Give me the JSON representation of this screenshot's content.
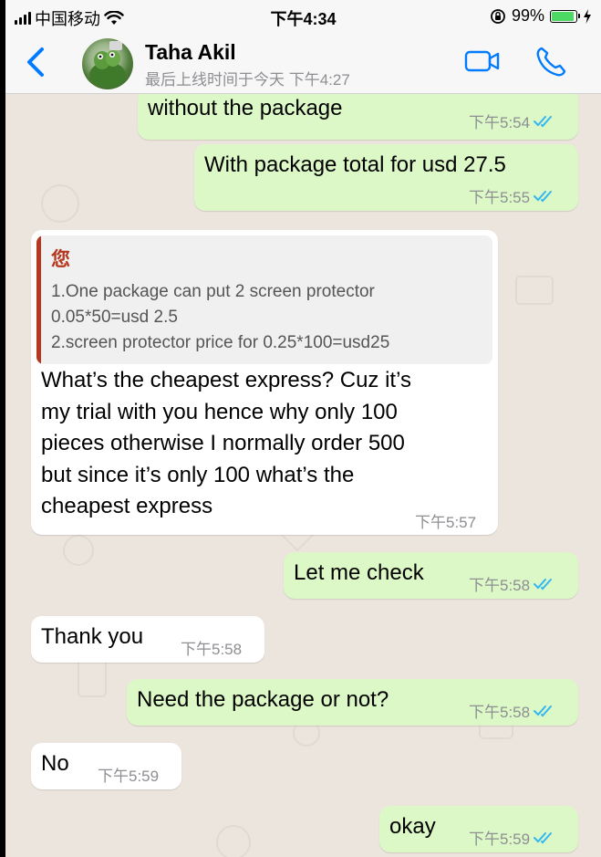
{
  "status_bar": {
    "carrier": "中国移动",
    "time": "下午4:34",
    "battery": "99%"
  },
  "header": {
    "contact_name": "Taha Akil",
    "last_seen": "最后上线时间于今天 下午4:27"
  },
  "colors": {
    "outgoing_bubble": "#DCF8C6",
    "incoming_bubble": "#FFFFFF",
    "chat_background": "#ECE5DD",
    "accent_blue": "#007AFF",
    "read_ticks": "#34B7F1",
    "quote_author": "#B5371F"
  },
  "messages": [
    {
      "direction": "out",
      "text": "without the package",
      "time": "下午5:54",
      "read": true
    },
    {
      "direction": "out",
      "text": "With package total for usd 27.5",
      "time": "下午5:55",
      "read": true
    },
    {
      "direction": "in",
      "quote": {
        "author": "您",
        "lines": [
          "1.One package can put 2 screen protector",
          "0.05*50=usd 2.5",
          "2.screen protector price for 0.25*100=usd25"
        ]
      },
      "lines": [
        "What’s the cheapest express? Cuz it’s",
        "my trial with you hence why only 100",
        "pieces otherwise I normally order 500",
        "but since it’s only 100 what’s the",
        "cheapest express"
      ],
      "time": "下午5:57"
    },
    {
      "direction": "out",
      "text": "Let me check",
      "time": "下午5:58",
      "read": true
    },
    {
      "direction": "in",
      "text": "Thank you",
      "time": "下午5:58"
    },
    {
      "direction": "out",
      "text": "Need the package or not?",
      "time": "下午5:58",
      "read": true
    },
    {
      "direction": "in",
      "text": "No",
      "time": "下午5:59"
    },
    {
      "direction": "out",
      "text": "okay",
      "time": "下午5:59",
      "read": true
    }
  ]
}
